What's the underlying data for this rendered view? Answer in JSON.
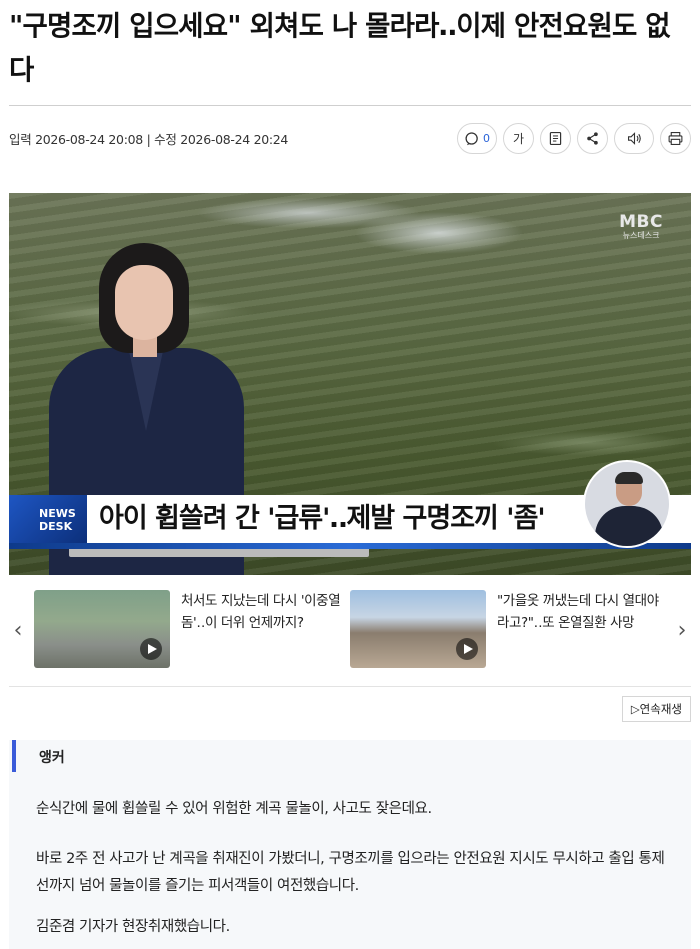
{
  "article": {
    "headline": "\"구명조끼 입으세요\" 외쳐도 나 몰라라‥이제 안전요원도 없다",
    "meta": "입력 2026-08-24 20:08 | 수정 2026-08-24 20:24"
  },
  "toolbar": {
    "comment_count": "0",
    "font_size_label": "가"
  },
  "video": {
    "logo": "MBC",
    "logo_sub": "뉴스데스크",
    "program_tag": "NEWS DESK",
    "caption": "아이 휩쓸려 간 '급류'‥제발 구명조끼 '좀'"
  },
  "related": [
    {
      "title": "처서도 지났는데 다시 '이중열돔'‥이 더위 언제까지?"
    },
    {
      "title": "\"가을옷 꺼냈는데 다시 열대야라고?\"‥또 온열질환 사망"
    }
  ],
  "autoplay_label": "▷연속재생",
  "body": {
    "label": "앵커",
    "paragraphs": [
      "순식간에 물에 휩쓸릴 수 있어 위험한 계곡 물놀이, 사고도 잦은데요.",
      "바로 2주 전 사고가 난 계곡을 취재진이 가봤더니, 구명조끼를 입으라는 안전요원 지시도 무시하고 출입 통제선까지 넘어 물놀이를 즐기는 피서객들이 여전했습니다.",
      "김준겸 기자가 현장취재했습니다."
    ]
  }
}
